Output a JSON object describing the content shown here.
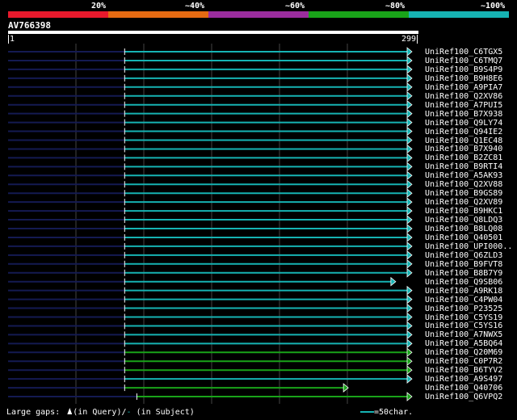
{
  "scale": {
    "labels": [
      "20%",
      "~40%",
      "~60%",
      "~80%",
      "~100%"
    ],
    "colors": [
      "#e8192c",
      "#e56a12",
      "#9b2d9e",
      "#19a319",
      "#16b3b3"
    ]
  },
  "query": {
    "name": "AV766398",
    "start": "1",
    "end": "299",
    "length": 299
  },
  "chart_data": {
    "type": "alignment-overview",
    "query_length": 299,
    "hits": [
      {
        "name": "UniRef100_C6TGX5",
        "q_start": 87,
        "q_end": 299,
        "identity_bin": "~100%"
      },
      {
        "name": "UniRef100_C6TMQ7",
        "q_start": 87,
        "q_end": 299,
        "identity_bin": "~100%"
      },
      {
        "name": "UniRef100_B9S4P9",
        "q_start": 87,
        "q_end": 299,
        "identity_bin": "~100%"
      },
      {
        "name": "UniRef100_B9H8E6",
        "q_start": 87,
        "q_end": 299,
        "identity_bin": "~100%"
      },
      {
        "name": "UniRef100_A9PIA7",
        "q_start": 87,
        "q_end": 299,
        "identity_bin": "~100%"
      },
      {
        "name": "UniRef100_Q2XV86",
        "q_start": 87,
        "q_end": 299,
        "identity_bin": "~100%"
      },
      {
        "name": "UniRef100_A7PUI5",
        "q_start": 87,
        "q_end": 299,
        "identity_bin": "~100%"
      },
      {
        "name": "UniRef100_B7X938",
        "q_start": 87,
        "q_end": 299,
        "identity_bin": "~100%"
      },
      {
        "name": "UniRef100_Q9LY74",
        "q_start": 87,
        "q_end": 299,
        "identity_bin": "~100%"
      },
      {
        "name": "UniRef100_Q94IE2",
        "q_start": 87,
        "q_end": 299,
        "identity_bin": "~100%"
      },
      {
        "name": "UniRef100_Q1EC48",
        "q_start": 87,
        "q_end": 299,
        "identity_bin": "~100%"
      },
      {
        "name": "UniRef100_B7X940",
        "q_start": 87,
        "q_end": 299,
        "identity_bin": "~100%"
      },
      {
        "name": "UniRef100_B2ZC81",
        "q_start": 87,
        "q_end": 299,
        "identity_bin": "~100%"
      },
      {
        "name": "UniRef100_B9RTI4",
        "q_start": 87,
        "q_end": 299,
        "identity_bin": "~100%"
      },
      {
        "name": "UniRef100_A5AK93",
        "q_start": 87,
        "q_end": 299,
        "identity_bin": "~100%"
      },
      {
        "name": "UniRef100_Q2XV88",
        "q_start": 87,
        "q_end": 299,
        "identity_bin": "~100%"
      },
      {
        "name": "UniRef100_B9GS89",
        "q_start": 87,
        "q_end": 299,
        "identity_bin": "~100%"
      },
      {
        "name": "UniRef100_Q2XV89",
        "q_start": 87,
        "q_end": 299,
        "identity_bin": "~100%"
      },
      {
        "name": "UniRef100_B9HKC1",
        "q_start": 87,
        "q_end": 299,
        "identity_bin": "~100%"
      },
      {
        "name": "UniRef100_Q8LDQ3",
        "q_start": 87,
        "q_end": 299,
        "identity_bin": "~100%"
      },
      {
        "name": "UniRef100_B8LQ08",
        "q_start": 87,
        "q_end": 299,
        "identity_bin": "~100%"
      },
      {
        "name": "UniRef100_Q40501",
        "q_start": 87,
        "q_end": 299,
        "identity_bin": "~100%"
      },
      {
        "name": "UniRef100_UPI000..",
        "q_start": 87,
        "q_end": 299,
        "identity_bin": "~100%"
      },
      {
        "name": "UniRef100_Q6ZLD3",
        "q_start": 87,
        "q_end": 299,
        "identity_bin": "~100%"
      },
      {
        "name": "UniRef100_B9FVT8",
        "q_start": 87,
        "q_end": 299,
        "identity_bin": "~100%"
      },
      {
        "name": "UniRef100_B8B7Y9",
        "q_start": 87,
        "q_end": 299,
        "identity_bin": "~100%"
      },
      {
        "name": "UniRef100_Q9SB06",
        "q_start": 87,
        "q_end": 287,
        "identity_bin": "~100%"
      },
      {
        "name": "UniRef100_A9RK18",
        "q_start": 87,
        "q_end": 299,
        "identity_bin": "~100%"
      },
      {
        "name": "UniRef100_C4PW04",
        "q_start": 87,
        "q_end": 299,
        "identity_bin": "~100%"
      },
      {
        "name": "UniRef100_P23525",
        "q_start": 87,
        "q_end": 299,
        "identity_bin": "~100%"
      },
      {
        "name": "UniRef100_C5YS19",
        "q_start": 87,
        "q_end": 299,
        "identity_bin": "~100%"
      },
      {
        "name": "UniRef100_C5YS16",
        "q_start": 87,
        "q_end": 299,
        "identity_bin": "~100%"
      },
      {
        "name": "UniRef100_A7NWX5",
        "q_start": 87,
        "q_end": 299,
        "identity_bin": "~100%"
      },
      {
        "name": "UniRef100_A5BQ64",
        "q_start": 87,
        "q_end": 299,
        "identity_bin": "~100%"
      },
      {
        "name": "UniRef100_Q20M69",
        "q_start": 87,
        "q_end": 299,
        "identity_bin": "~80%"
      },
      {
        "name": "UniRef100_C0P7R2",
        "q_start": 87,
        "q_end": 299,
        "identity_bin": "~80%"
      },
      {
        "name": "UniRef100_B6TYV2",
        "q_start": 87,
        "q_end": 299,
        "identity_bin": "~80%"
      },
      {
        "name": "UniRef100_A9S497",
        "q_start": 87,
        "q_end": 299,
        "identity_bin": "~100%"
      },
      {
        "name": "UniRef100_Q40706",
        "q_start": 87,
        "q_end": 252,
        "identity_bin": "~80%"
      },
      {
        "name": "UniRef100_Q6VPQ2",
        "q_start": 96,
        "q_end": 299,
        "identity_bin": "~80%"
      }
    ]
  },
  "footer": {
    "gaps_label": "Large gaps:",
    "query_gap_label": "(in Query)/",
    "subject_gap_label": "(in Subject)",
    "scale_label": "=50char."
  }
}
